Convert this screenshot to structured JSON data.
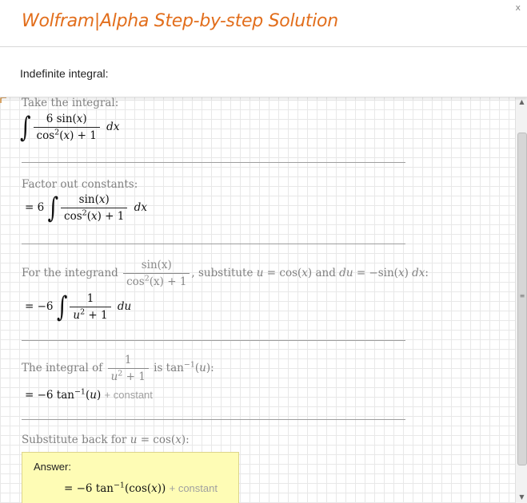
{
  "header": {
    "title": "Wolfram|Alpha Step-by-step Solution",
    "close_label": "x"
  },
  "subheader": {
    "label": "Indefinite integral:"
  },
  "steps": [
    {
      "label": "Take the integral:",
      "integral": "∫",
      "coeff_num": "6 sin(",
      "var": "x",
      "close": ")",
      "den_a": "cos",
      "den_exp": "2",
      "den_b": "(",
      "den_c": ") + 1",
      "dx": "dx"
    },
    {
      "label": "Factor out constants:",
      "prefix": "= 6",
      "integral": "∫",
      "num_a": "sin(",
      "var": "x",
      "close": ")",
      "den_a": "cos",
      "den_exp": "2",
      "den_b": "(",
      "den_c": ") + 1",
      "dx": "dx"
    },
    {
      "label_a": "For the integrand",
      "frac_num": "sin(x)",
      "frac_den_a": "cos",
      "frac_den_exp": "2",
      "frac_den_b": "(x) + 1",
      "label_b": ", substitute",
      "sub_u": "u",
      "sub_eq": "= cos(",
      "sub_x": "x",
      "sub_close": ")",
      "label_c": "and",
      "sub_du": "du",
      "sub_eq2": "= −sin(",
      "sub_x2": "x",
      "sub_close2": ")",
      "sub_dx": "dx",
      "colon": ":",
      "prefix": "= −6",
      "integral": "∫",
      "num": "1",
      "den_u": "u",
      "den_exp": "2",
      "den_c": "+ 1",
      "du": "du"
    },
    {
      "label_a": "The integral of",
      "frac_num": "1",
      "frac_den_u": "u",
      "frac_den_exp": "2",
      "frac_den_c": "+ 1",
      "label_b": "is tan",
      "label_exp": "−1",
      "label_c": "(",
      "label_u": "u",
      "label_d": "):",
      "result_a": "= −6 tan",
      "result_exp": "−1",
      "result_b": "(",
      "result_u": "u",
      "result_c": ")",
      "constant": "+ constant"
    },
    {
      "label_a": "Substitute back for",
      "label_u": "u",
      "label_b": "= cos(",
      "label_x": "x",
      "label_c": "):"
    }
  ],
  "answer": {
    "label": "Answer:",
    "expr_a": "= −6 tan",
    "expr_exp": "−1",
    "expr_b": "(cos(",
    "expr_x": "x",
    "expr_c": "))",
    "constant": "+ constant"
  },
  "scrollbar": {
    "up_icon": "▲",
    "down_icon": "▼",
    "grip_icon": "≡"
  }
}
